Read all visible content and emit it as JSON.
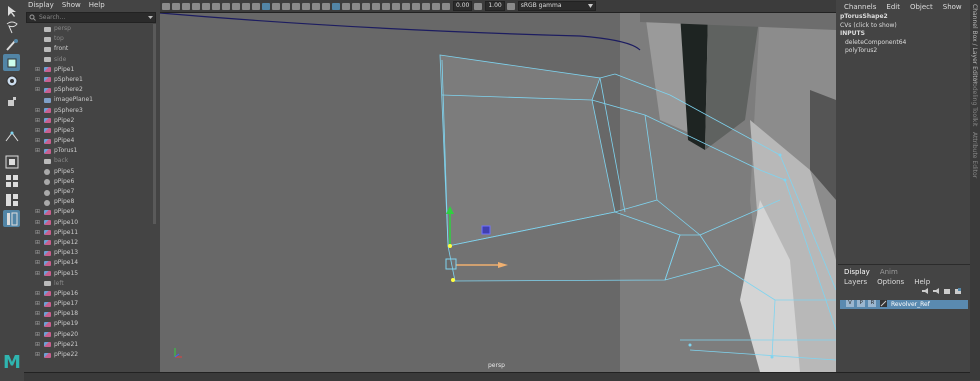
{
  "outliner": {
    "menu": [
      "Display",
      "Show",
      "Help"
    ],
    "search_placeholder": "Search...",
    "items": [
      {
        "label": "persp",
        "icon": "camera",
        "dim": true,
        "expand": false
      },
      {
        "label": "top",
        "icon": "camera",
        "dim": true,
        "expand": false
      },
      {
        "label": "front",
        "icon": "camera",
        "dim": false,
        "expand": false
      },
      {
        "label": "side",
        "icon": "camera",
        "dim": true,
        "expand": false
      },
      {
        "label": "pPipe1",
        "icon": "mesh",
        "dim": false,
        "expand": true
      },
      {
        "label": "pSphere1",
        "icon": "mesh",
        "dim": false,
        "expand": true
      },
      {
        "label": "pSphere2",
        "icon": "mesh",
        "dim": false,
        "expand": true
      },
      {
        "label": "imagePlane1",
        "icon": "image",
        "dim": false,
        "expand": false
      },
      {
        "label": "pSphere3",
        "icon": "mesh",
        "dim": false,
        "expand": true
      },
      {
        "label": "pPipe2",
        "icon": "mesh",
        "dim": false,
        "expand": true
      },
      {
        "label": "pPipe3",
        "icon": "mesh",
        "dim": false,
        "expand": true
      },
      {
        "label": "pPipe4",
        "icon": "mesh",
        "dim": false,
        "expand": true
      },
      {
        "label": "pTorus1",
        "icon": "mesh",
        "dim": false,
        "expand": true
      },
      {
        "label": "back",
        "icon": "camera",
        "dim": true,
        "expand": false
      },
      {
        "label": "pPipe5",
        "icon": "group",
        "dim": false,
        "expand": false
      },
      {
        "label": "pPipe6",
        "icon": "group",
        "dim": false,
        "expand": false
      },
      {
        "label": "pPipe7",
        "icon": "group",
        "dim": false,
        "expand": false
      },
      {
        "label": "pPipe8",
        "icon": "group",
        "dim": false,
        "expand": false
      },
      {
        "label": "pPipe9",
        "icon": "mesh",
        "dim": false,
        "expand": true
      },
      {
        "label": "pPipe10",
        "icon": "mesh",
        "dim": false,
        "expand": true
      },
      {
        "label": "pPipe11",
        "icon": "mesh",
        "dim": false,
        "expand": true
      },
      {
        "label": "pPipe12",
        "icon": "mesh",
        "dim": false,
        "expand": true
      },
      {
        "label": "pPipe13",
        "icon": "mesh",
        "dim": false,
        "expand": true
      },
      {
        "label": "pPipe14",
        "icon": "mesh",
        "dim": false,
        "expand": true
      },
      {
        "label": "pPipe15",
        "icon": "mesh",
        "dim": false,
        "expand": true
      },
      {
        "label": "left",
        "icon": "camera",
        "dim": true,
        "expand": false
      },
      {
        "label": "pPipe16",
        "icon": "mesh",
        "dim": false,
        "expand": true
      },
      {
        "label": "pPipe17",
        "icon": "mesh",
        "dim": false,
        "expand": true
      },
      {
        "label": "pPipe18",
        "icon": "mesh",
        "dim": false,
        "expand": true
      },
      {
        "label": "pPipe19",
        "icon": "mesh",
        "dim": false,
        "expand": true
      },
      {
        "label": "pPipe20",
        "icon": "mesh",
        "dim": false,
        "expand": true
      },
      {
        "label": "pPipe21",
        "icon": "mesh",
        "dim": false,
        "expand": true
      },
      {
        "label": "pPipe22",
        "icon": "mesh",
        "dim": false,
        "expand": true
      }
    ]
  },
  "viewport": {
    "camera_label": "persp",
    "exposure": "0.00",
    "gamma": "1.00",
    "color_space": "sRGB gamma"
  },
  "channel_box": {
    "tabs": [
      "Channels",
      "Edit",
      "Object",
      "Show"
    ],
    "object_name": "pTorusShape2",
    "cvs": "CVs (click to show)",
    "inputs_header": "INPUTS",
    "inputs": [
      "deleteComponent64",
      "polyTorus2"
    ]
  },
  "side_tabs": [
    "Channel Box / Layer Editor",
    "Modeling Toolkit",
    "Attribute Editor"
  ],
  "layer_editor": {
    "tabs": [
      "Display",
      "Anim"
    ],
    "menu": [
      "Layers",
      "Options",
      "Help"
    ],
    "layer": {
      "v": "V",
      "p": "P",
      "r": "R",
      "name": "Revolver_Ref"
    }
  },
  "brand": {
    "logo": "M",
    "accent": "#5285a6",
    "wire": "#7fd4f0"
  }
}
